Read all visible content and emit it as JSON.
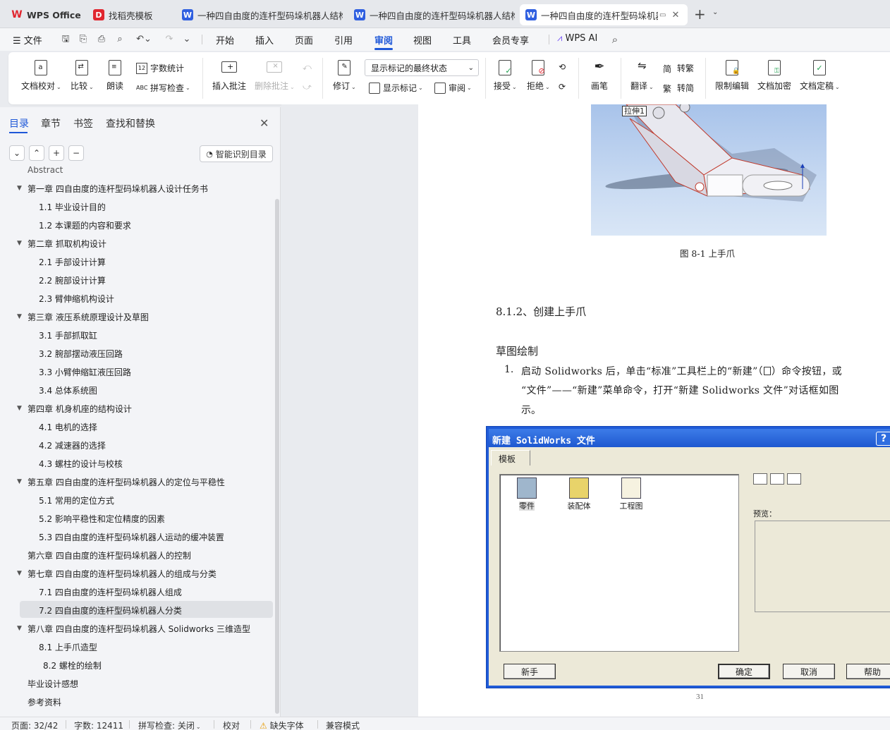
{
  "tabs": [
    {
      "label": "WPS Office",
      "icon": "wps-logo-icon",
      "color": "#e0262f"
    },
    {
      "label": "找稻壳模板",
      "icon": "docer-icon",
      "color": "#e0262f"
    },
    {
      "label": "一种四自由度的连杆型码垛机器人结构",
      "icon": "word-doc-icon",
      "color": "#2f5fe0"
    },
    {
      "label": "一种四自由度的连杆型码垛机器人结构",
      "icon": "word-doc-icon",
      "color": "#2f5fe0"
    },
    {
      "label": "一种四自由度的连杆型码垛机器人",
      "icon": "word-doc-icon",
      "color": "#2f5fe0"
    }
  ],
  "menu": {
    "file": "文件",
    "items": [
      "开始",
      "插入",
      "页面",
      "引用",
      "审阅",
      "视图",
      "工具",
      "会员专享"
    ],
    "active": "审阅",
    "wps_ai": "WPS AI"
  },
  "ribbon": {
    "proofread": "文档校对",
    "compare": "比较",
    "read_aloud": "朗读",
    "word_count": "字数统计",
    "spell_check": "拼写检查",
    "insert_comment": "插入批注",
    "delete_comment": "删除批注",
    "track_changes": "修订",
    "markup_state": "显示标记的最终状态",
    "show_markup": "显示标记",
    "review_pane": "审阅",
    "accept": "接受",
    "reject": "拒绝",
    "pen": "画笔",
    "translate": "翻译",
    "to_traditional": "转繁",
    "to_simplified": "转简",
    "restrict_edit": "限制编辑",
    "encrypt": "文档加密",
    "finalize": "文档定稿"
  },
  "panel": {
    "tabs": [
      "目录",
      "章节",
      "书签",
      "查找和替换"
    ],
    "smart_toc": "智能识别目录",
    "toc": [
      {
        "label": "Abstract",
        "level": 1,
        "toggle": false
      },
      {
        "label": "第一章  四自由度的连杆型码垛机器人设计任务书",
        "level": 1,
        "toggle": true
      },
      {
        "label": "1.1 毕业设计目的",
        "level": 2
      },
      {
        "label": "1.2 本课题的内容和要求",
        "level": 2
      },
      {
        "label": "第二章  抓取机构设计",
        "level": 1,
        "toggle": true
      },
      {
        "label": "2.1 手部设计计算",
        "level": 2
      },
      {
        "label": "2.2 腕部设计计算",
        "level": 2
      },
      {
        "label": "2.3 臂伸缩机构设计",
        "level": 2
      },
      {
        "label": "第三章  液压系统原理设计及草图",
        "level": 1,
        "toggle": true
      },
      {
        "label": "3.1 手部抓取缸",
        "level": 2
      },
      {
        "label": "3.2 腕部摆动液压回路",
        "level": 2
      },
      {
        "label": "3.3 小臂伸缩缸液压回路",
        "level": 2
      },
      {
        "label": "3.4 总体系统图",
        "level": 2
      },
      {
        "label": "第四章  机身机座的结构设计",
        "level": 1,
        "toggle": true
      },
      {
        "label": "4.1 电机的选择",
        "level": 2
      },
      {
        "label": "4.2 减速器的选择",
        "level": 2
      },
      {
        "label": "4.3 螺柱的设计与校核",
        "level": 2
      },
      {
        "label": "第五章  四自由度的连杆型码垛机器人的定位与平稳性",
        "level": 1,
        "toggle": true
      },
      {
        "label": "5.1 常用的定位方式",
        "level": 2
      },
      {
        "label": "5.2 影响平稳性和定位精度的因素",
        "level": 2
      },
      {
        "label": "5.3 四自由度的连杆型码垛机器人运动的缓冲装置",
        "level": 2
      },
      {
        "label": "第六章  四自由度的连杆型码垛机器人的控制",
        "level": 1,
        "toggle": false
      },
      {
        "label": "第七章  四自由度的连杆型码垛机器人的组成与分类",
        "level": 1,
        "toggle": true
      },
      {
        "label": "7.1 四自由度的连杆型码垛机器人组成",
        "level": 2
      },
      {
        "label": "7.2 四自由度的连杆型码垛机器人分类",
        "level": 2,
        "selected": true
      },
      {
        "label": "第八章  四自由度的连杆型码垛机器人 Solidworks 三维造型",
        "level": 1,
        "toggle": true
      },
      {
        "label": "8.1 上手爪造型",
        "level": 2
      },
      {
        "label": "8.2 螺栓的绘制",
        "level": 3
      },
      {
        "label": "毕业设计感想",
        "level": 1,
        "toggle": false
      },
      {
        "label": "参考资料",
        "level": 1,
        "toggle": false
      }
    ]
  },
  "document": {
    "fig_tag": "拉伸1",
    "fig_caption": "图 8-1 上手爪",
    "heading": "8.1.2、创建上手爪",
    "subheading": "草图绘制",
    "list_num": "1.",
    "para_line1_a": "启动 Solidworks 后，单击“标准”工具栏上的“新建”（",
    "para_line1_b": "）命令按钮，或",
    "para_line2": "“文件”——“新建”菜单命令，打开“新建 Solidworks 文件”对话框如图",
    "para_line3": "示。",
    "page_number": "31",
    "dialog": {
      "title": "新建 SolidWorks 文件",
      "help": "?",
      "tab": "模板",
      "templates": [
        "零件",
        "装配体",
        "工程图"
      ],
      "preview_label": "预览：",
      "novice": "新手",
      "ok": "确定",
      "cancel": "取消",
      "help_btn": "帮助"
    }
  },
  "status": {
    "page": "页面: 32/42",
    "words": "字数: 12411",
    "spell": "拼写检查: 关闭",
    "proof": "校对",
    "missing_font": "缺失字体",
    "compat": "兼容模式"
  }
}
